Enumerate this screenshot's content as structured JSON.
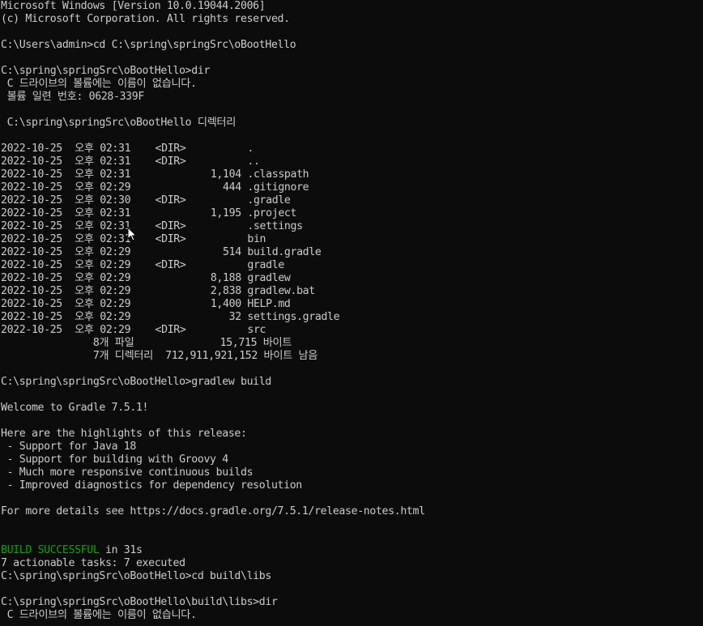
{
  "terminal": {
    "colors": {
      "background": "#0c0c0c",
      "text": "#cccccc",
      "success": "#13a10e"
    },
    "lines": [
      {
        "segments": [
          {
            "text": "Microsoft Windows [Version 10.0.19044.2006]"
          }
        ]
      },
      {
        "segments": [
          {
            "text": "(c) Microsoft Corporation. All rights reserved."
          }
        ]
      },
      {
        "segments": [
          {
            "text": ""
          }
        ]
      },
      {
        "segments": [
          {
            "text": "C:\\Users\\admin>cd C:\\spring\\springSrc\\oBootHello"
          }
        ]
      },
      {
        "segments": [
          {
            "text": ""
          }
        ]
      },
      {
        "segments": [
          {
            "text": "C:\\spring\\springSrc\\oBootHello>dir"
          }
        ]
      },
      {
        "segments": [
          {
            "text": " C 드라이브의 볼륨에는 이름이 없습니다."
          }
        ]
      },
      {
        "segments": [
          {
            "text": " 볼륨 일련 번호: 0628-339F"
          }
        ]
      },
      {
        "segments": [
          {
            "text": ""
          }
        ]
      },
      {
        "segments": [
          {
            "text": " C:\\spring\\springSrc\\oBootHello 디렉터리"
          }
        ]
      },
      {
        "segments": [
          {
            "text": ""
          }
        ]
      },
      {
        "segments": [
          {
            "text": "2022-10-25  오후 02:31    <DIR>          ."
          }
        ]
      },
      {
        "segments": [
          {
            "text": "2022-10-25  오후 02:31    <DIR>          .."
          }
        ]
      },
      {
        "segments": [
          {
            "text": "2022-10-25  오후 02:31             1,104 .classpath"
          }
        ]
      },
      {
        "segments": [
          {
            "text": "2022-10-25  오후 02:29               444 .gitignore"
          }
        ]
      },
      {
        "segments": [
          {
            "text": "2022-10-25  오후 02:30    <DIR>          .gradle"
          }
        ]
      },
      {
        "segments": [
          {
            "text": "2022-10-25  오후 02:31             1,195 .project"
          }
        ]
      },
      {
        "segments": [
          {
            "text": "2022-10-25  오후 02:31    <DIR>          .settings"
          }
        ]
      },
      {
        "segments": [
          {
            "text": "2022-10-25  오후 02:31    <DIR>          bin"
          }
        ]
      },
      {
        "segments": [
          {
            "text": "2022-10-25  오후 02:29               514 build.gradle"
          }
        ]
      },
      {
        "segments": [
          {
            "text": "2022-10-25  오후 02:29    <DIR>          gradle"
          }
        ]
      },
      {
        "segments": [
          {
            "text": "2022-10-25  오후 02:29             8,188 gradlew"
          }
        ]
      },
      {
        "segments": [
          {
            "text": "2022-10-25  오후 02:29             2,838 gradlew.bat"
          }
        ]
      },
      {
        "segments": [
          {
            "text": "2022-10-25  오후 02:29             1,400 HELP.md"
          }
        ]
      },
      {
        "segments": [
          {
            "text": "2022-10-25  오후 02:29                32 settings.gradle"
          }
        ]
      },
      {
        "segments": [
          {
            "text": "2022-10-25  오후 02:29    <DIR>          src"
          }
        ]
      },
      {
        "segments": [
          {
            "text": "               8개 파일              15,715 바이트"
          }
        ]
      },
      {
        "segments": [
          {
            "text": "               7개 디렉터리  712,911,921,152 바이트 남음"
          }
        ]
      },
      {
        "segments": [
          {
            "text": ""
          }
        ]
      },
      {
        "segments": [
          {
            "text": "C:\\spring\\springSrc\\oBootHello>gradlew build"
          }
        ]
      },
      {
        "segments": [
          {
            "text": ""
          }
        ]
      },
      {
        "segments": [
          {
            "text": "Welcome to Gradle 7.5.1!"
          }
        ]
      },
      {
        "segments": [
          {
            "text": ""
          }
        ]
      },
      {
        "segments": [
          {
            "text": "Here are the highlights of this release:"
          }
        ]
      },
      {
        "segments": [
          {
            "text": " - Support for Java 18"
          }
        ]
      },
      {
        "segments": [
          {
            "text": " - Support for building with Groovy 4"
          }
        ]
      },
      {
        "segments": [
          {
            "text": " - Much more responsive continuous builds"
          }
        ]
      },
      {
        "segments": [
          {
            "text": " - Improved diagnostics for dependency resolution"
          }
        ]
      },
      {
        "segments": [
          {
            "text": ""
          }
        ]
      },
      {
        "segments": [
          {
            "text": "For more details see https://docs.gradle.org/7.5.1/release-notes.html"
          }
        ]
      },
      {
        "segments": [
          {
            "text": ""
          }
        ]
      },
      {
        "segments": [
          {
            "text": ""
          }
        ]
      },
      {
        "segments": [
          {
            "text": "BUILD SUCCESSFUL",
            "style": "green"
          },
          {
            "text": " in 31s"
          }
        ]
      },
      {
        "segments": [
          {
            "text": "7 actionable tasks: 7 executed"
          }
        ]
      },
      {
        "segments": [
          {
            "text": "C:\\spring\\springSrc\\oBootHello>cd build\\libs"
          }
        ]
      },
      {
        "segments": [
          {
            "text": ""
          }
        ]
      },
      {
        "segments": [
          {
            "text": "C:\\spring\\springSrc\\oBootHello\\build\\libs>dir"
          }
        ]
      },
      {
        "segments": [
          {
            "text": " C 드라이브의 볼륨에는 이름이 없습니다."
          }
        ]
      }
    ],
    "pointer_icon": "mouse-pointer-icon"
  }
}
